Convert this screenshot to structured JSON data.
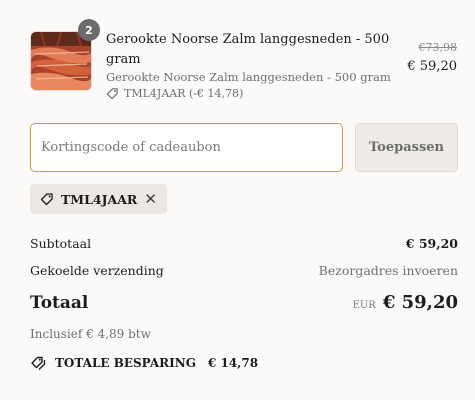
{
  "cart": {
    "item": {
      "quantity": "2",
      "name": "Gerookte Noorse Zalm langgesneden - 500 gram",
      "variant": "Gerookte Noorse Zalm langgesneden - 500 gram",
      "discount": "TML4JAAR (-€ 14,78)",
      "price_original": "€73,98",
      "price_current": "€ 59,20",
      "thumbnail_icon": "smoked-salmon-image"
    }
  },
  "discount_form": {
    "placeholder": "Kortingscode of cadeaubon",
    "value": "",
    "apply_label": "Toepassen"
  },
  "applied_code": {
    "code": "TML4JAAR",
    "remove_icon": "close-icon",
    "tag_icon": "tag-icon"
  },
  "summary": {
    "subtotal_label": "Subtotaal",
    "subtotal_value": "€ 59,20",
    "shipping_label": "Gekoelde verzending",
    "shipping_value": "Bezorgadres invoeren",
    "total_label": "Totaal",
    "currency": "EUR",
    "total_value": "€ 59,20",
    "tax_note": "Inclusief € 4,89 btw",
    "savings_label": "TOTALE BESPARING",
    "savings_value": "€ 14,78",
    "savings_icon": "tags-icon"
  },
  "colors": {
    "background": "#fbfaf8",
    "input_focus_border": "#c9a04a",
    "badge": "#6b6b6b",
    "button_bg": "#eeebe7",
    "chip_bg": "#ebe8e4"
  }
}
